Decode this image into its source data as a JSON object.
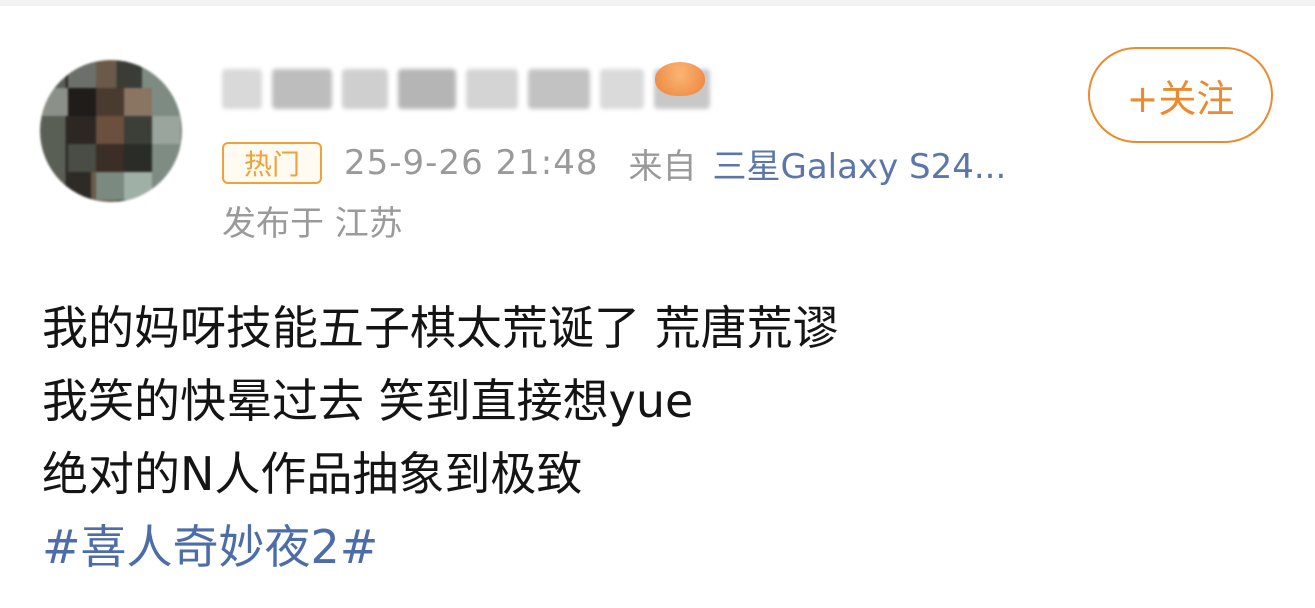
{
  "post": {
    "author": {
      "nickname_blurred": true,
      "avatar_blurred": true
    },
    "follow_button": "+关注",
    "hot_badge": "热门",
    "time": "25-9-26 21:48",
    "source_prefix": "来自",
    "source_device": "三星Galaxy S24...",
    "location": "发布于 江苏",
    "lines": [
      "我的妈呀技能五子棋太荒诞了 荒唐荒谬",
      "我笑的快晕过去 笑到直接想yue",
      "绝对的N人作品抽象到极致"
    ],
    "hashtag": "#喜人奇妙夜2#"
  },
  "colors": {
    "accent_orange": "#ee8a2e",
    "link_blue": "#4d6da8",
    "meta_gray": "#9a9a9a",
    "text": "#141414"
  }
}
